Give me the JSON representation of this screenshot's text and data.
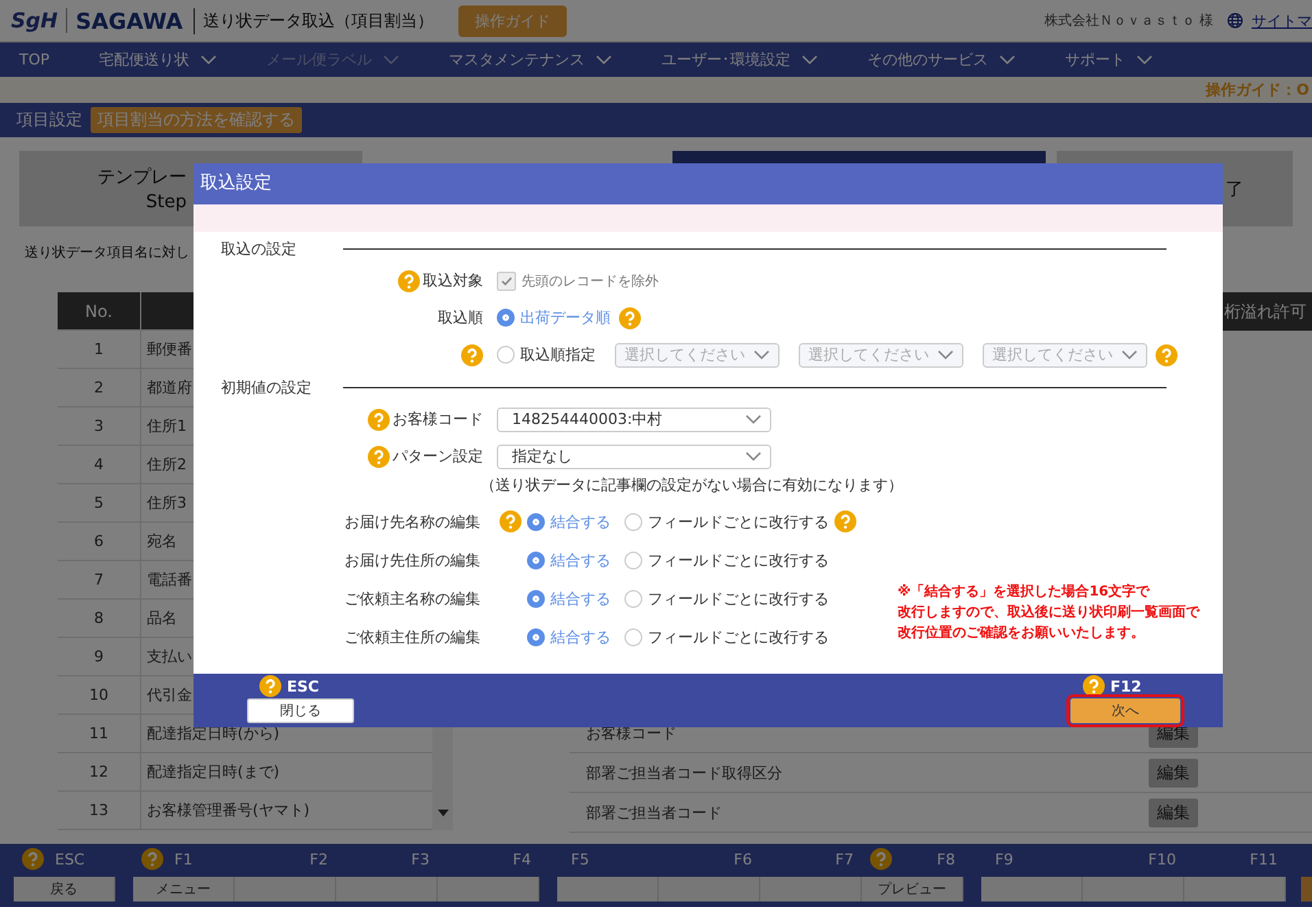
{
  "header": {
    "logo_mark": "SgH",
    "logo_text": "SAGAWA",
    "title": "送り状データ取込（項目割当）",
    "guide_button": "操作ガイド",
    "company": "株式会社Ｎｏｖａｓｔｏ 様",
    "sitemap_link": "サイトマ"
  },
  "nav": [
    {
      "label": "TOP",
      "dropdown": false,
      "disabled": false
    },
    {
      "label": "宅配便送り状",
      "dropdown": true,
      "disabled": false
    },
    {
      "label": "メール便ラベル",
      "dropdown": true,
      "disabled": true
    },
    {
      "label": "マスタメンテナンス",
      "dropdown": true,
      "disabled": false
    },
    {
      "label": "ユーザー･環境設定",
      "dropdown": true,
      "disabled": false
    },
    {
      "label": "その他のサービス",
      "dropdown": true,
      "disabled": false
    },
    {
      "label": "サポート",
      "dropdown": true,
      "disabled": false
    }
  ],
  "guide_line": "操作ガイド：O",
  "subheader": {
    "title": "項目設定",
    "tag": "項目割当の方法を確認する"
  },
  "steps": [
    {
      "lines": [
        "テンプレー",
        "Step"
      ],
      "selected": false
    },
    {
      "selected": true
    },
    {
      "lines": [
        "了"
      ],
      "selected": false
    }
  ],
  "caption": "送り状データ項目名に対し",
  "left_table": {
    "columns": [
      "No."
    ],
    "rows": [
      {
        "no": "1",
        "name": "郵便番"
      },
      {
        "no": "2",
        "name": "都道府"
      },
      {
        "no": "3",
        "name": "住所1"
      },
      {
        "no": "4",
        "name": "住所2"
      },
      {
        "no": "5",
        "name": "住所3"
      },
      {
        "no": "6",
        "name": "宛名"
      },
      {
        "no": "7",
        "name": "電話番"
      },
      {
        "no": "8",
        "name": "品名"
      },
      {
        "no": "9",
        "name": "支払い"
      },
      {
        "no": "10",
        "name": "代引金"
      },
      {
        "no": "11",
        "name": "配達指定日時(から)"
      },
      {
        "no": "12",
        "name": "配達指定日時(まで)"
      },
      {
        "no": "13",
        "name": "お客様管理番号(ヤマト)"
      }
    ]
  },
  "right_table": {
    "last_column": "桁溢れ許可",
    "rows": [
      {
        "name": "お客様コード",
        "edit": "編集"
      },
      {
        "name": "部署ご担当者コード取得区分",
        "edit": "編集"
      },
      {
        "name": "部署ご担当者コード",
        "edit": "編集"
      }
    ]
  },
  "function_keys": [
    [
      {
        "key": "ESC",
        "help": true,
        "label": "戻る"
      }
    ],
    [
      {
        "key": "F1",
        "help": true,
        "label": "メニュー"
      },
      {
        "key": "F2",
        "help": false
      },
      {
        "key": "F3",
        "help": false
      },
      {
        "key": "F4",
        "help": false
      }
    ],
    [
      {
        "key": "F5",
        "help": false
      },
      {
        "key": "F6",
        "help": false
      },
      {
        "key": "F7",
        "help": false
      },
      {
        "key": "F8",
        "help": true,
        "label": "プレビュー"
      }
    ],
    [
      {
        "key": "F9",
        "help": false
      },
      {
        "key": "F10",
        "help": false
      },
      {
        "key": "F11",
        "help": false
      }
    ]
  ],
  "modal": {
    "title": "取込設定",
    "sections": [
      {
        "heading": "取込の設定",
        "rows": [
          {
            "kind": "checkbox",
            "help": true,
            "label": "取込対象",
            "checked": true,
            "disabled": true,
            "text": "先頭のレコードを除外"
          },
          {
            "kind": "radio",
            "label": "取込順",
            "option": {
              "text": "出荷データ順",
              "selected": true
            },
            "help_after": true
          },
          {
            "kind": "radio",
            "help": true,
            "option": {
              "text": "取込順指定",
              "selected": false
            },
            "selects": [
              {
                "placeholder": "選択してください",
                "disabled": true
              },
              {
                "placeholder": "選択してください",
                "disabled": true
              },
              {
                "placeholder": "選択してください",
                "disabled": true
              }
            ],
            "help_end": true
          }
        ]
      },
      {
        "heading": "初期値の設定",
        "rows": [
          {
            "kind": "select",
            "help": true,
            "label": "お客様コード",
            "value": "148254440003:中村"
          },
          {
            "kind": "select",
            "help": true,
            "label": "パターン設定",
            "value": "指定なし",
            "note": "（送り状データに記事欄の設定がない場合に有効になります）"
          }
        ]
      }
    ],
    "edit_rows": [
      {
        "label": "お届け先名称の編集",
        "help": true,
        "options": [
          {
            "text": "結合する",
            "selected": true
          },
          {
            "text": "フィールドごとに改行する",
            "selected": false
          }
        ],
        "help_after": true
      },
      {
        "label": "お届け先住所の編集",
        "options": [
          {
            "text": "結合する",
            "selected": true
          },
          {
            "text": "フィールドごとに改行する",
            "selected": false
          }
        ]
      },
      {
        "label": "ご依頼主名称の編集",
        "options": [
          {
            "text": "結合する",
            "selected": true
          },
          {
            "text": "フィールドごとに改行する",
            "selected": false
          }
        ]
      },
      {
        "label": "ご依頼主住所の編集",
        "options": [
          {
            "text": "結合する",
            "selected": true
          },
          {
            "text": "フィールドごとに改行する",
            "selected": false
          }
        ]
      }
    ],
    "note_lines": [
      "※「結合する」を選択した場合16文字で",
      "改行しますので、取込後に送り状印刷一覧画面で",
      "改行位置のご確認をお願いいたします。"
    ],
    "footer": {
      "close": {
        "key": "ESC",
        "help": true,
        "label": "閉じる"
      },
      "next": {
        "key": "F12",
        "help": true,
        "label": "次へ",
        "focused": true
      }
    }
  }
}
